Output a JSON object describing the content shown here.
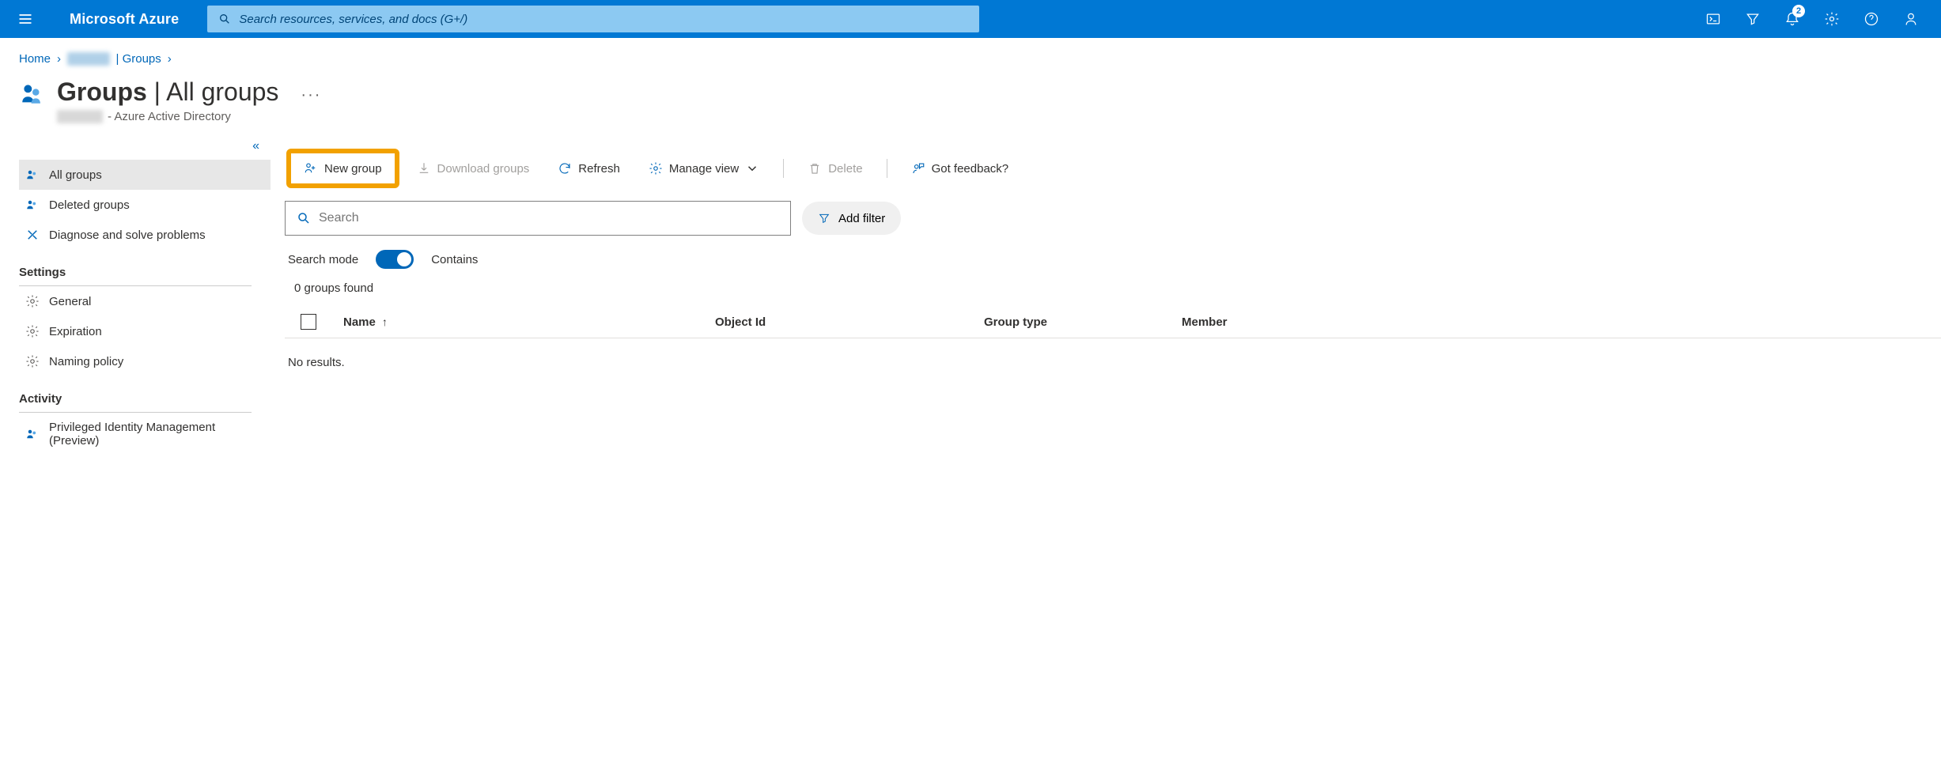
{
  "brand": "Microsoft Azure",
  "search_placeholder": "Search resources, services, and docs (G+/)",
  "notification_count": "2",
  "breadcrumb": {
    "home": "Home",
    "tenant": "xxxxx",
    "groups": "| Groups"
  },
  "title": {
    "main": "Groups",
    "sub": "All groups",
    "subtitle_tenant": "xxxx",
    "subtitle_suffix": " - Azure Active Directory"
  },
  "sidebar": {
    "items": [
      {
        "label": "All groups"
      },
      {
        "label": "Deleted groups"
      },
      {
        "label": "Diagnose and solve problems"
      }
    ],
    "settings_header": "Settings",
    "settings": [
      {
        "label": "General"
      },
      {
        "label": "Expiration"
      },
      {
        "label": "Naming policy"
      }
    ],
    "activity_header": "Activity",
    "activity": [
      {
        "label": "Privileged Identity Management (Preview)"
      }
    ]
  },
  "toolbar": {
    "new_group": "New group",
    "download": "Download groups",
    "refresh": "Refresh",
    "manage_view": "Manage view",
    "delete": "Delete",
    "feedback": "Got feedback?"
  },
  "group_search_placeholder": "Search",
  "add_filter": "Add filter",
  "search_mode_label": "Search mode",
  "search_mode_value": "Contains",
  "found_text": "0 groups found",
  "columns": {
    "name": "Name",
    "object_id": "Object Id",
    "group_type": "Group type",
    "membership": "Member"
  },
  "no_results": "No results."
}
